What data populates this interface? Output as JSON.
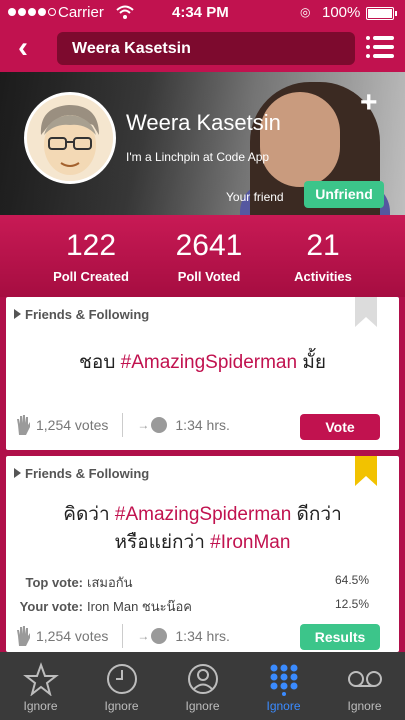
{
  "status_bar": {
    "carrier": "Carrier",
    "time": "4:34 PM",
    "battery": "100%"
  },
  "nav": {
    "title": "Weera Kasetsin"
  },
  "profile": {
    "name": "Weera Kasetsin",
    "tagline": "I'm a Linchpin at Code App",
    "friend_status": "Your friend",
    "unfriend_label": "Unfriend",
    "add_label": "+"
  },
  "stats": [
    {
      "value": "122",
      "label": "Poll Created"
    },
    {
      "value": "2641",
      "label": "Poll Voted"
    },
    {
      "value": "21",
      "label": "Activities"
    }
  ],
  "polls": [
    {
      "section": "Friends & Following",
      "question_pre": "ชอบ ",
      "question_tag": "#AmazingSpiderman",
      "question_post": " มั้ย",
      "votes": "1,254 votes",
      "time": "1:34 hrs.",
      "action": "Vote",
      "ribbon_color": "#dcdcdc"
    },
    {
      "section": "Friends & Following",
      "line1_pre": "คิดว่า ",
      "line1_tag": "#AmazingSpiderman",
      "line1_post": " ดีกว่า",
      "line2_pre": "หรือแย่กว่า ",
      "line2_tag": "#IronMan",
      "top_vote_label": "Top vote:",
      "top_vote_value": "เสมอกัน",
      "top_vote_pct": "64.5%",
      "your_vote_label": "Your vote:",
      "your_vote_value": "Iron Man ชนะน๊อค",
      "your_vote_pct": "12.5%",
      "votes": "1,254 votes",
      "time": "1:34 hrs.",
      "action": "Results",
      "ribbon_color": "#f2c200"
    }
  ],
  "tabs": [
    {
      "label": "Ignore",
      "icon": "star-icon",
      "active": false
    },
    {
      "label": "Ignore",
      "icon": "clock-icon",
      "active": false
    },
    {
      "label": "Ignore",
      "icon": "person-icon",
      "active": false
    },
    {
      "label": "Ignore",
      "icon": "grid-icon",
      "active": true
    },
    {
      "label": "Ignore",
      "icon": "voicemail-icon",
      "active": false
    }
  ],
  "colors": {
    "brand": "#c1124f",
    "success": "#3cc58a",
    "active_tab": "#3a8bff"
  }
}
